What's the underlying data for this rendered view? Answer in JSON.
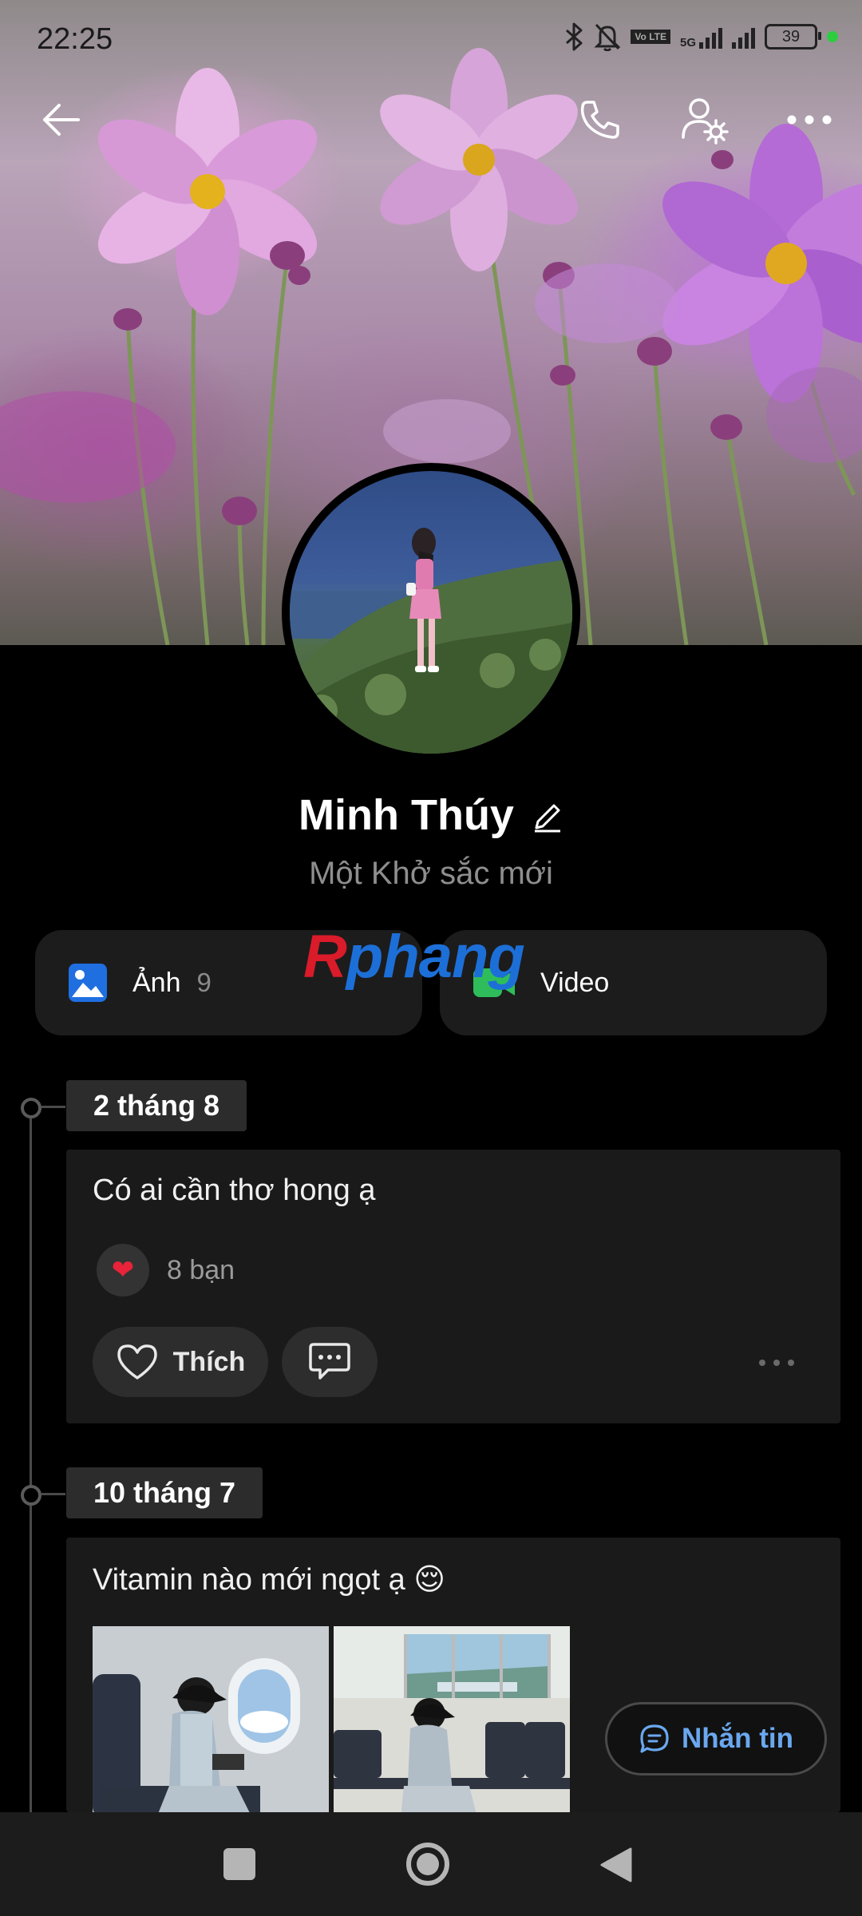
{
  "status_bar": {
    "time": "22:25",
    "network_5g": "5G",
    "volte": "Vo LTE",
    "battery": "39",
    "icons": [
      "bluetooth-icon",
      "bell-off-icon",
      "volte-icon",
      "signal-5g-icon",
      "signal-icon",
      "battery-icon",
      "active-dot-icon"
    ]
  },
  "top_bar": {
    "icons": [
      "back-arrow-icon",
      "phone-icon",
      "user-settings-icon",
      "more-horizontal-icon"
    ]
  },
  "profile": {
    "name": "Minh Thúy",
    "status": "Một Khở sắc mới"
  },
  "media": {
    "photos_label": "Ảnh",
    "photos_count": "9",
    "video_label": "Video"
  },
  "watermark": {
    "first": "R",
    "rest": "phang"
  },
  "posts": [
    {
      "date": "2 tháng 8",
      "text": "Có ai cần thơ hong ạ",
      "reaction_count": "8 bạn",
      "like_label": "Thích"
    },
    {
      "date": "10 tháng 7",
      "text": "Vitamin nào mới ngọt ạ 😌"
    }
  ],
  "message_button": {
    "label": "Nhắn tin"
  },
  "colors": {
    "background": "#000000",
    "card": "#1a1a1a",
    "accent_blue": "#6aa8ef",
    "heart_red": "#e8233a",
    "video_green": "#2ebd5a",
    "photo_blue": "#1f6fe0"
  }
}
